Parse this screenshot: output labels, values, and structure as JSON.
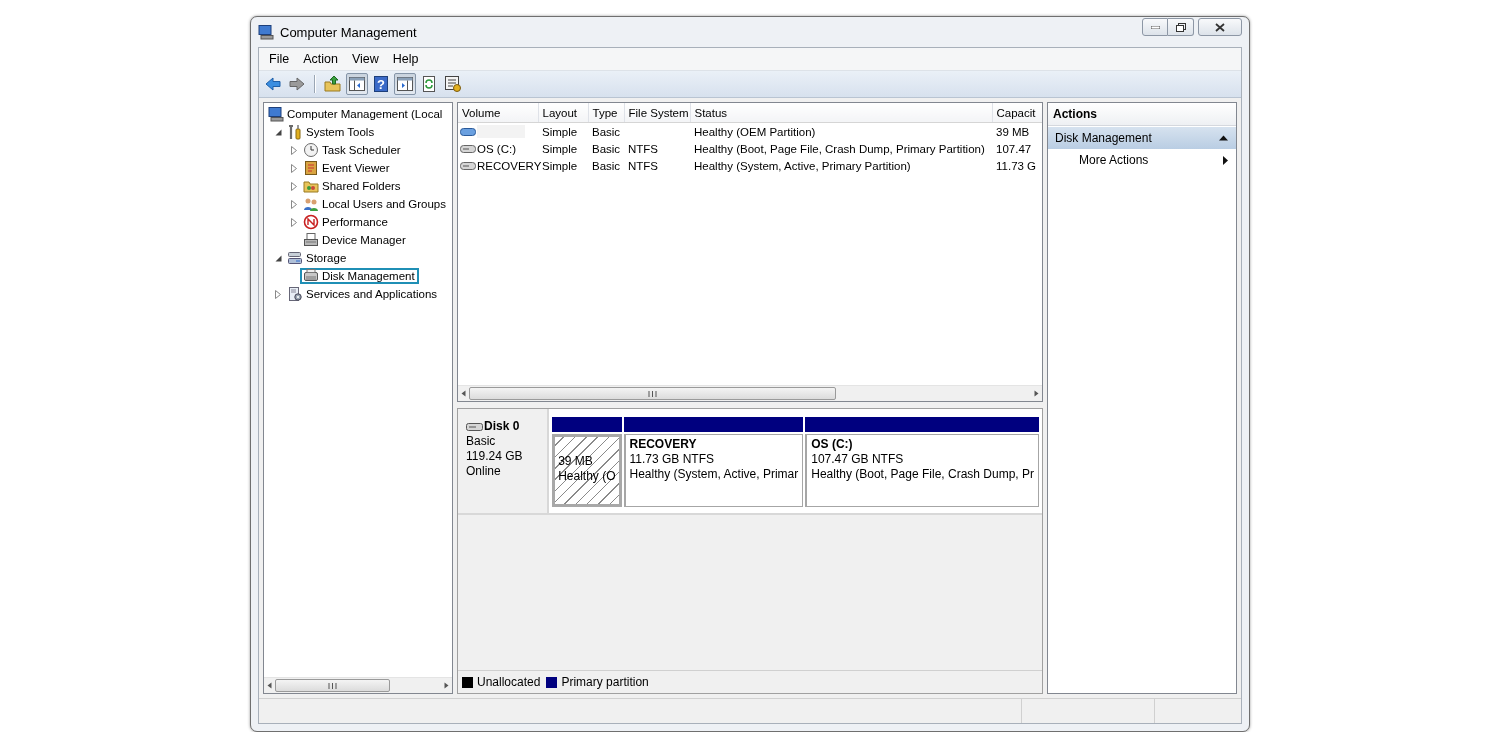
{
  "window": {
    "title": "Computer Management"
  },
  "menu": [
    "File",
    "Action",
    "View",
    "Help"
  ],
  "toolbar": [
    {
      "kind": "back"
    },
    {
      "kind": "forward"
    },
    {
      "kind": "separator"
    },
    {
      "kind": "up"
    },
    {
      "kind": "tree-toggle",
      "pressed": true
    },
    {
      "kind": "help",
      "label": "?"
    },
    {
      "kind": "action-toggle",
      "pressed": true
    },
    {
      "kind": "refresh"
    },
    {
      "kind": "properties"
    }
  ],
  "tree": [
    {
      "label": "Computer Management (Local",
      "kind": "computer",
      "selected": false,
      "children": [
        {
          "label": "System Tools",
          "kind": "tools",
          "expanded": true,
          "selected": false,
          "children": [
            {
              "label": "Task Scheduler",
              "kind": "clock",
              "expanded": false,
              "selected": false
            },
            {
              "label": "Event Viewer",
              "kind": "log",
              "expanded": false,
              "selected": false
            },
            {
              "label": "Shared Folders",
              "kind": "folder",
              "expanded": false,
              "selected": false
            },
            {
              "label": "Local Users and Groups",
              "kind": "users",
              "expanded": false,
              "selected": false
            },
            {
              "label": "Performance",
              "kind": "performance",
              "expanded": false,
              "selected": false
            },
            {
              "label": "Device Manager",
              "kind": "device",
              "selected": false
            }
          ]
        },
        {
          "label": "Storage",
          "kind": "storage",
          "expanded": true,
          "selected": false,
          "children": [
            {
              "label": "Disk Management",
              "kind": "disk",
              "selected": true
            }
          ]
        },
        {
          "label": "Services and Applications",
          "kind": "services",
          "expanded": false,
          "selected": false
        }
      ]
    }
  ],
  "volumes": {
    "columns": [
      "Volume",
      "Layout",
      "Type",
      "File System",
      "Status",
      "Capacit"
    ],
    "rows": [
      {
        "kind": "oem",
        "layout": "Simple",
        "type": "Basic",
        "status": "Healthy (OEM Partition)",
        "capacity": "39 MB"
      },
      {
        "kind": "volume",
        "volume": "OS (C:)",
        "layout": "Simple",
        "type": "Basic",
        "file_system": "NTFS",
        "status": "Healthy (Boot, Page File, Crash Dump, Primary Partition)",
        "capacity": "107.47"
      },
      {
        "kind": "volume",
        "volume": "RECOVERY",
        "layout": "Simple",
        "type": "Basic",
        "file_system": "NTFS",
        "status": "Healthy (System, Active, Primary Partition)",
        "capacity": "11.73 G"
      }
    ]
  },
  "disks": [
    {
      "name": "Disk 0",
      "type": "Basic",
      "size": "119.24 GB",
      "status": "Online",
      "partitions": [
        {
          "size": "39 MB",
          "status": "Healthy (O",
          "selected": true,
          "color": "#00007f"
        },
        {
          "name": "RECOVERY",
          "size": "11.73 GB NTFS",
          "status": "Healthy (System, Active, Primar",
          "selected": false,
          "color": "#00007f"
        },
        {
          "name": "OS  (C:)",
          "size": "107.47 GB NTFS",
          "status": "Healthy (Boot, Page File, Crash Dump, Pr",
          "selected": false,
          "color": "#00007f"
        }
      ]
    }
  ],
  "legend": [
    {
      "label": "Unallocated",
      "color": "#000000"
    },
    {
      "label": "Primary partition",
      "color": "#00007f"
    }
  ],
  "actions": {
    "title": "Actions",
    "sections": [
      {
        "label": "Disk Management",
        "expanded": true,
        "items": [
          "More Actions"
        ]
      }
    ]
  }
}
